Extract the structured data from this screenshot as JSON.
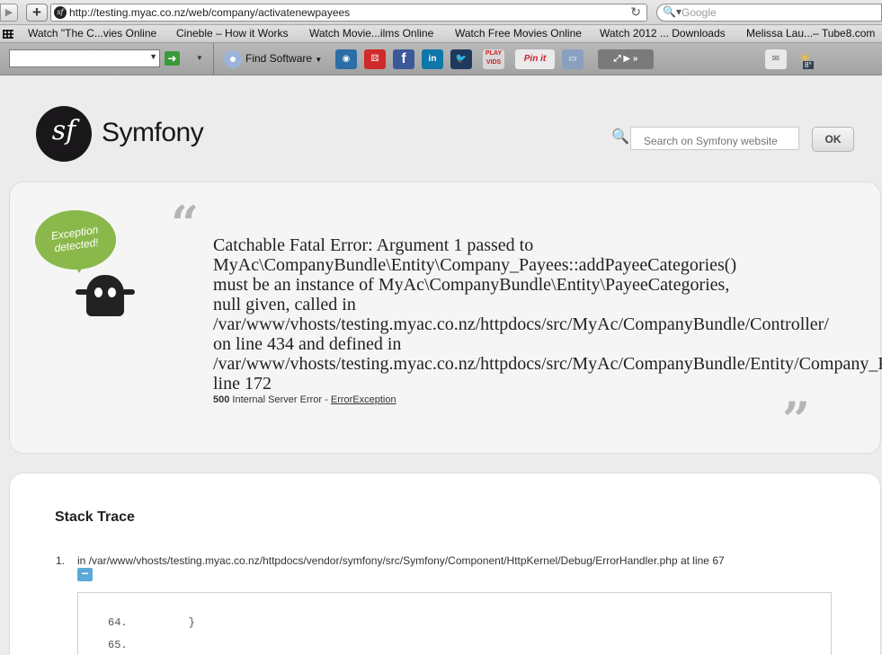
{
  "browser": {
    "url": "http://testing.myac.co.nz/web/company/activatenewpayees",
    "search_placeholder": "Google",
    "bookmarks": [
      "Watch \"The C...vies Online",
      "Cineble – How it Works",
      "Watch Movie...ilms Online",
      "Watch Free Movies Online",
      "Watch 2012 ... Downloads",
      "Melissa Lau...– Tube8.com"
    ],
    "toolbar": {
      "find_software": "Find Software",
      "play_vids": "PLAY VIDS",
      "pinit": "Pin it",
      "weather_temp": "8°"
    }
  },
  "page": {
    "brand": "Symfony",
    "search_placeholder": "Search on Symfony website",
    "ok_label": "OK",
    "bubble_text": "Exception detected!",
    "error_lines": [
      "Catchable Fatal Error: Argument 1 passed to",
      "MyAc\\CompanyBundle\\Entity\\Company_Payees::addPayeeCategories()",
      "must be an instance of MyAc\\CompanyBundle\\Entity\\PayeeCategories,",
      "null given, called in",
      "/var/www/vhosts/testing.myac.co.nz/httpdocs/src/MyAc/CompanyBundle/Controller/",
      "on line 434 and defined in",
      "/var/www/vhosts/testing.myac.co.nz/httpdocs/src/MyAc/CompanyBundle/Entity/Company_Payees.php",
      "line 172"
    ],
    "status_code": "500",
    "status_text": "Internal Server Error -",
    "exception_class": "ErrorException",
    "trace_title": "Stack Trace",
    "trace_items": [
      {
        "num": "1.",
        "text": "in /var/www/vhosts/testing.myac.co.nz/httpdocs/vendor/symfony/src/Symfony/Component/HttpKernel/Debug/ErrorHandler.php at line 67",
        "toggle": "−",
        "code": [
          {
            "line": "64.",
            "code": "        }"
          },
          {
            "line": "65.",
            "code": ""
          }
        ]
      }
    ]
  }
}
